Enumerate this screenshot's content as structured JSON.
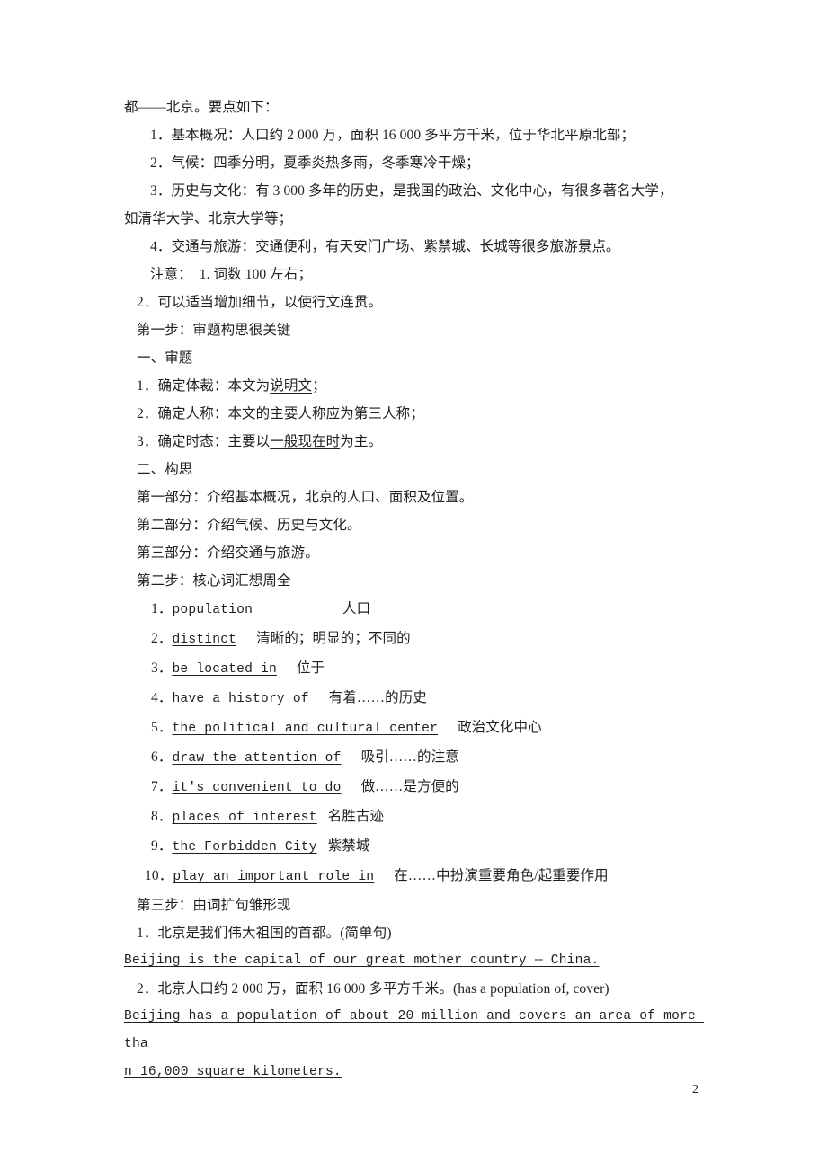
{
  "document": {
    "page_number": "2",
    "intro_line": "都——北京。要点如下：",
    "prompt_items": [
      "1．基本概况：人口约 2 000 万，面积 16 000 多平方千米，位于华北平原北部；",
      "2．气候：四季分明，夏季炎热多雨，冬季寒冷干燥；",
      "3．历史与文化：有 3 000 多年的历史，是我国的政治、文化中心，有很多著名大学，",
      "如清华大学、北京大学等；",
      "4．交通与旅游：交通便利，有天安门广场、紫禁城、长城等很多旅游景点。"
    ],
    "notes": [
      "注意：  1. 词数 100 左右；",
      "2．可以适当增加细节，以使行文连贯。"
    ],
    "step_one": {
      "heading": "第一步：审题构思很关键",
      "section_one_title": "一、审题",
      "section_one_items": [
        {
          "prefix": "1．确定体裁：本文为",
          "underlined": "说明文",
          "suffix": "；"
        },
        {
          "prefix": "2．确定人称：本文的主要人称应为第",
          "underlined": "三",
          "suffix": "人称；"
        },
        {
          "prefix": "3．确定时态：主要以",
          "underlined": "一般现在时",
          "suffix": "为主。"
        }
      ],
      "section_two_title": "二、构思",
      "section_two_items": [
        "第一部分：介绍基本概况，北京的人口、面积及位置。",
        "第二部分：介绍气候、历史与文化。",
        "第三部分：介绍交通与旅游。"
      ]
    },
    "step_two": {
      "heading": "第二步：核心词汇想周全",
      "vocabulary": [
        {
          "num": "1．",
          "english": "population",
          "gap": "lg",
          "chinese": "人口"
        },
        {
          "num": "2．",
          "english": "distinct",
          "gap": "md",
          "chinese": "清晰的；明显的；不同的"
        },
        {
          "num": "3．",
          "english": "be located in",
          "gap": "md",
          "chinese": "位于"
        },
        {
          "num": "4．",
          "english": "have a history of",
          "gap": "md",
          "chinese": "有着……的历史"
        },
        {
          "num": "5．",
          "english": "the political and cultural center",
          "gap": "md",
          "chinese": "政治文化中心"
        },
        {
          "num": "6．",
          "english": "draw the attention of",
          "gap": "md",
          "chinese": "吸引……的注意"
        },
        {
          "num": "7．",
          "english": "it's convenient to do",
          "gap": "md",
          "chinese": "做……是方便的"
        },
        {
          "num": "8．",
          "english": "places of interest",
          "gap": "sm",
          "chinese": "名胜古迹"
        },
        {
          "num": "9．",
          "english": "the Forbidden City",
          "gap": "sm",
          "chinese": "紫禁城"
        },
        {
          "num": "10．",
          "english": "play an important role in",
          "gap": "md",
          "chinese": "在……中扮演重要角色/起重要作用"
        }
      ]
    },
    "step_three": {
      "heading": "第三步：由词扩句雏形现",
      "sentences": [
        {
          "chinese": "1．北京是我们伟大祖国的首都。(简单句)",
          "english": "Beijing is the capital of our great mother country — China."
        },
        {
          "chinese": "2．北京人口约 2 000 万，面积 16 000 多平方千米。(has a population of, cover)",
          "english_line1": "Beijing has a population of about 20 million and covers an area of more tha",
          "english_line2": "n 16,000 square kilometers."
        }
      ]
    }
  }
}
